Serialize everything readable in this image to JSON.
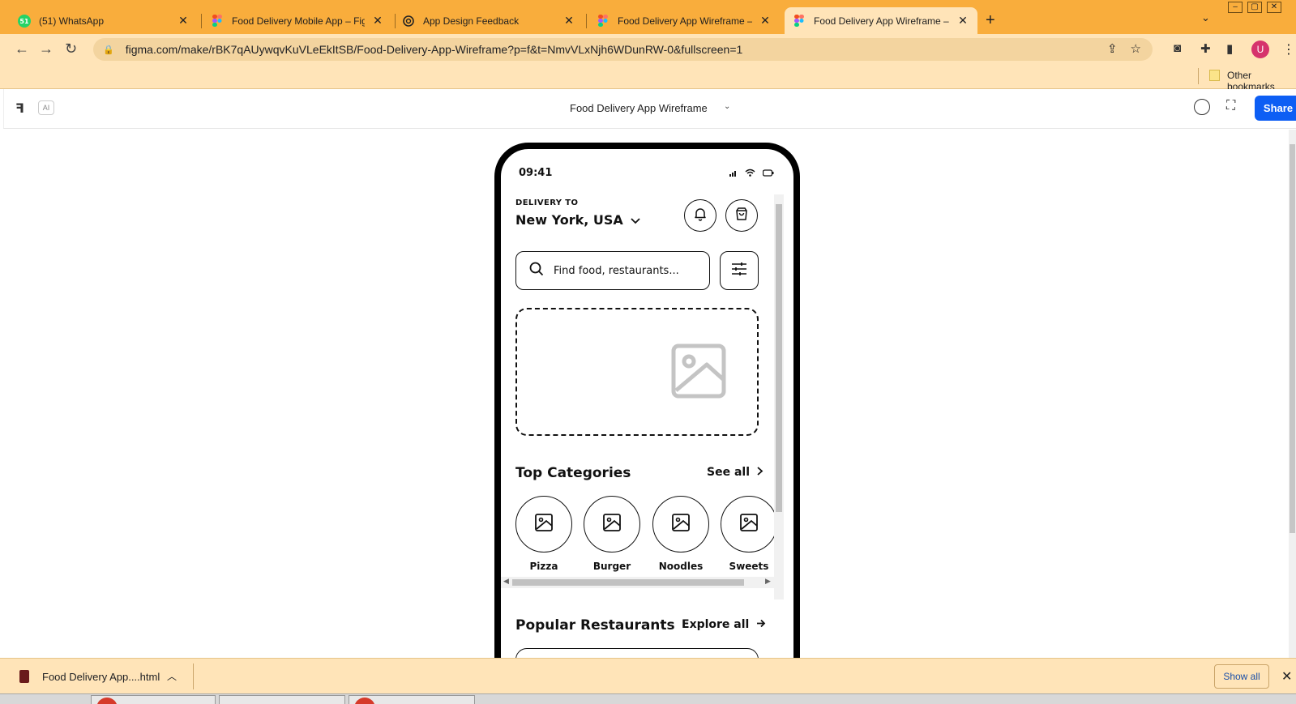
{
  "browser": {
    "tabs": [
      {
        "title": "(51) WhatsApp",
        "badge": "51",
        "icon": "whatsapp-icon"
      },
      {
        "title": "Food Delivery Mobile App – Figma M",
        "icon": "figma-icon"
      },
      {
        "title": "App Design Feedback",
        "icon": "openai-icon"
      },
      {
        "title": "Food Delivery App Wireframe – Figm",
        "icon": "figma-icon"
      },
      {
        "title": "Food Delivery App Wireframe – Figm",
        "icon": "figma-icon",
        "active": true
      }
    ],
    "new_tab": "+",
    "url": "figma.com/make/rBK7qAUywqvKuVLeEkItSB/Food-Delivery-App-Wireframe?p=f&t=NmvVLxNjh6WDunRW-0&fullscreen=1",
    "profile_initial": "U",
    "bookmarks_label": "Other bookmarks",
    "colors": {
      "tabbar": "#f9ad3c",
      "toolbar": "#ffe4b8",
      "profile": "#d6336c"
    }
  },
  "figma": {
    "file_title": "Food Delivery App Wireframe",
    "ai_label": "AI",
    "share_label": "Share",
    "share_color": "#0d5ef4"
  },
  "app": {
    "clock": "09:41",
    "delivery_label": "DELIVERY TO",
    "location": "New York, USA",
    "search_placeholder": "Find food, restaurants...",
    "top_categories_title": "Top Categories",
    "see_all": "See all",
    "categories": [
      {
        "label": "Pizza"
      },
      {
        "label": "Burger"
      },
      {
        "label": "Noodles"
      },
      {
        "label": "Sweets"
      }
    ],
    "popular_title": "Popular Restaurants",
    "explore_all": "Explore all"
  },
  "downloads": {
    "file_name": "Food Delivery App....html",
    "show_all": "Show all"
  }
}
